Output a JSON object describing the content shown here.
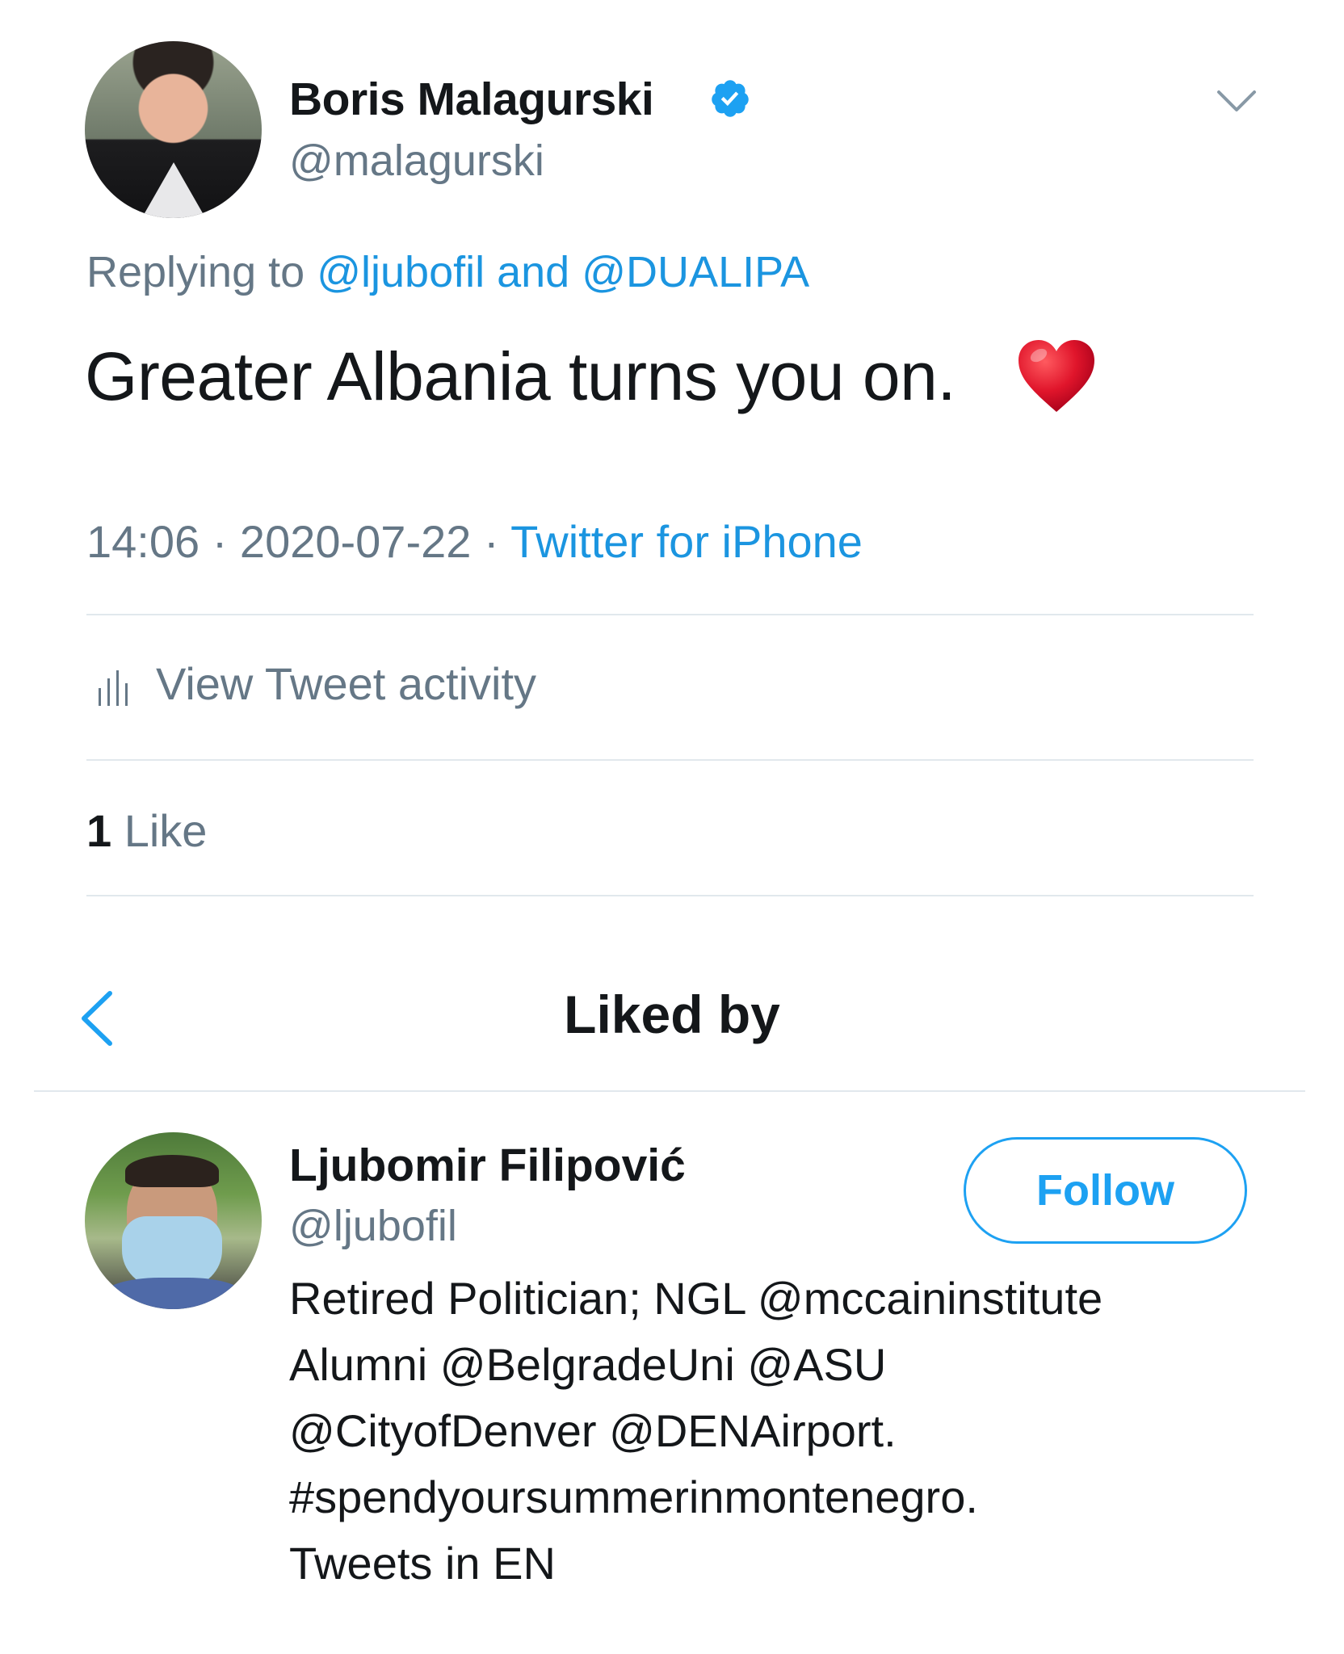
{
  "tweet": {
    "author_name": "Boris Malagurski",
    "author_handle": "@malagurski",
    "verified": true,
    "replying_prefix": "Replying to",
    "reply_to_1": "@ljubofil",
    "reply_conjunction": "and",
    "reply_to_2": "@DUALIPA",
    "text": "Greater Albania turns you on.",
    "emoji": "red-heart",
    "time": "14:06",
    "date": "2020-07-22",
    "separator": "·",
    "source": "Twitter for iPhone",
    "activity_label": "View Tweet activity",
    "like_count": "1",
    "like_label": "Like"
  },
  "liked_by": {
    "title": "Liked by",
    "users": [
      {
        "name": "Ljubomir Filipović",
        "handle": "@ljubofil",
        "follow_label": "Follow",
        "bio_lines": [
          "Retired Politician; NGL @mccaininstitute",
          "Alumni @BelgradeUni @ASU",
          "@CityofDenver @DENAirport.",
          "#spendyoursummerinmontenegro.",
          "Tweets in EN"
        ]
      }
    ]
  },
  "colors": {
    "link": "#1b95e0",
    "secondary_text": "#657786",
    "primary_text": "#14171a",
    "divider": "#e1e8ed",
    "heart": "#e0152b"
  }
}
